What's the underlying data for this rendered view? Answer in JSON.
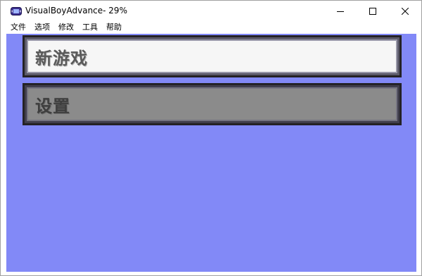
{
  "window": {
    "title": "VisualBoyAdvance- 29%",
    "icon": "gba-app-icon"
  },
  "controls": {
    "minimize": "minimize-icon",
    "maximize": "maximize-icon",
    "close": "close-icon"
  },
  "menu": {
    "items": [
      {
        "label": "文件"
      },
      {
        "label": "选项"
      },
      {
        "label": "修改"
      },
      {
        "label": "工具"
      },
      {
        "label": "帮助"
      }
    ]
  },
  "game": {
    "background": "#8289f7",
    "buttons": [
      {
        "label": "新游戏",
        "state": "selected"
      },
      {
        "label": "设置",
        "state": "unselected"
      }
    ]
  }
}
